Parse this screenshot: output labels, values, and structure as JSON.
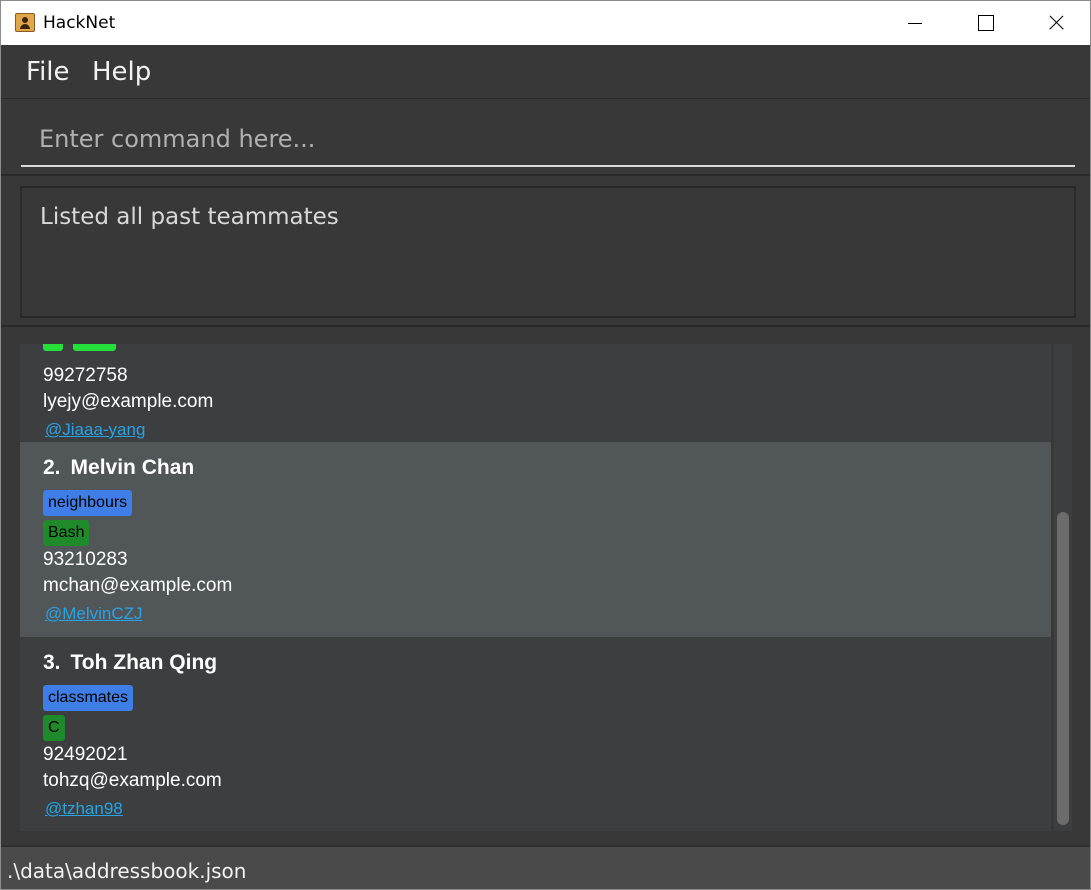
{
  "window": {
    "title": "HackNet",
    "app_icon": "address-book-icon",
    "controls": {
      "minimize": "minimize-icon",
      "maximize": "maximize-icon",
      "close": "close-icon"
    }
  },
  "menu": {
    "items": [
      {
        "label": "File"
      },
      {
        "label": "Help"
      }
    ]
  },
  "command": {
    "placeholder": "Enter command here...",
    "value": ""
  },
  "result": {
    "text": "Listed all past teammates"
  },
  "persons": [
    {
      "index": "",
      "name": "",
      "tags": [],
      "skills": [],
      "phone": "99272758",
      "email": "lyejy@example.com",
      "github": "@Jiaaa-yang",
      "partially_visible": true
    },
    {
      "index": "2.",
      "name": "Melvin Chan",
      "tags": [
        "neighbours"
      ],
      "skills": [
        "Bash"
      ],
      "phone": "93210283",
      "email": "mchan@example.com",
      "github": "@MelvinCZJ",
      "selected": true
    },
    {
      "index": "3.",
      "name": "Toh Zhan Qing",
      "tags": [
        "classmates"
      ],
      "skills": [
        "C"
      ],
      "phone": "92492021",
      "email": "tohzq@example.com",
      "github": "@tzhan98"
    }
  ],
  "status": {
    "path": ".\\data\\addressbook.json"
  },
  "colors": {
    "background": "#383838",
    "card": "#3c3e3f",
    "card_selected": "#515658",
    "tag": "#3e7ee6",
    "skill": "#1f8a2a",
    "link": "#27a4e8"
  }
}
